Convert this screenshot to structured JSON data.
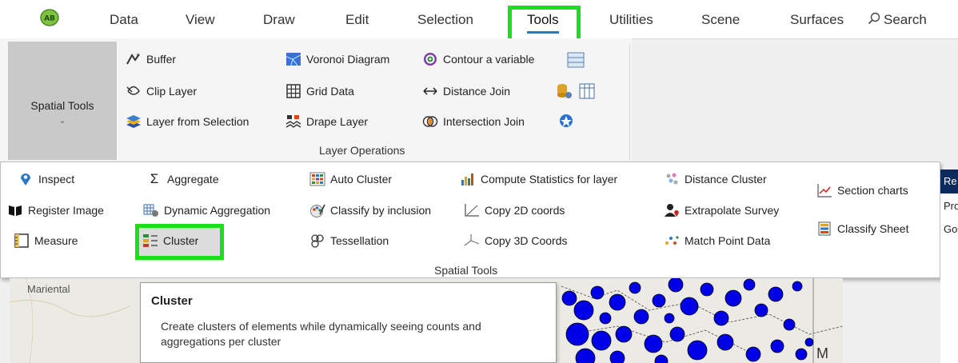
{
  "tabs": {
    "data": "Data",
    "view": "View",
    "draw": "Draw",
    "edit": "Edit",
    "selection": "Selection",
    "tools": "Tools",
    "utilities": "Utilities",
    "scene": "Scene",
    "surfaces": "Surfaces",
    "search": "Search"
  },
  "app_logo": "AB",
  "ribbon": {
    "spatial_tools_button": "Spatial Tools",
    "buffer": "Buffer",
    "clip_layer": "Clip Layer",
    "layer_from_selection": "Layer from Selection",
    "voronoi_diagram": "Voronoi Diagram",
    "grid_data": "Grid Data",
    "drape_layer": "Drape Layer",
    "contour_variable": "Contour a variable",
    "distance_join": "Distance Join",
    "intersection_join": "Intersection Join",
    "group_label": "Layer Operations"
  },
  "spatial_tools_menu": {
    "inspect": "Inspect",
    "register_image": "Register Image",
    "measure": "Measure",
    "aggregate": "Aggregate",
    "dynamic_aggregation": "Dynamic Aggregation",
    "cluster": "Cluster",
    "auto_cluster": "Auto Cluster",
    "classify_by_inclusion": "Classify by inclusion",
    "tessellation": "Tessellation",
    "compute_statistics": "Compute Statistics for layer",
    "copy_2d": "Copy 2D coords",
    "copy_3d": "Copy 3D Coords",
    "distance_cluster": "Distance Cluster",
    "extrapolate_survey": "Extrapolate Survey",
    "match_point_data": "Match Point Data",
    "section_charts": "Section charts",
    "classify_sheet": "Classify Sheet",
    "group_label": "Spatial Tools"
  },
  "right_panel": {
    "row1": "Re",
    "row2": "Pro",
    "row3": "Go"
  },
  "map": {
    "place_label": "Mariental",
    "edge_label": "M"
  },
  "tooltip": {
    "title": "Cluster",
    "description": "Create clusters of elements while dynamically seeing counts and aggregations per cluster"
  },
  "colors": {
    "highlight": "#19e019",
    "accent": "#2b79c2",
    "dots": "#0000e6",
    "header": "#0c2a5c"
  }
}
